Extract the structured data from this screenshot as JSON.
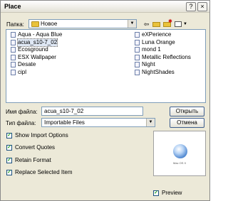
{
  "window": {
    "title": "Place",
    "help_label": "?",
    "close_label": "×"
  },
  "folder": {
    "label": "Папка:",
    "value": "Новое"
  },
  "files": {
    "left": [
      "Aqua - Aqua Blue",
      "acua_s10-7_02",
      "Ecosground",
      "ESX Wallpaper",
      "Desate",
      "cipl"
    ],
    "right": [
      "eXPerience",
      "Luna Orange",
      "mond 1",
      "Metallic Reflections",
      "Night",
      "NightShades"
    ],
    "selected": "acua_s10-7_02"
  },
  "filename": {
    "label": "Имя файла:",
    "value": "acua_s10-7_02"
  },
  "filetype": {
    "label": "Тип файла:",
    "value": "Importable Files"
  },
  "buttons": {
    "open": "Открыть",
    "cancel": "Отмена"
  },
  "options": [
    {
      "label": "Show Import Options",
      "checked": true
    },
    {
      "label": "Convert Quotes",
      "checked": true
    },
    {
      "label": "Retain Format",
      "checked": true
    },
    {
      "label": "Replace Selected Item",
      "checked": true
    }
  ],
  "preview": {
    "label": "Preview",
    "checked": true,
    "thumb_caption": "Mac OS X"
  },
  "icons": [
    "folder-icon",
    "back-arrow-icon",
    "up-folder-icon",
    "new-folder-icon",
    "view-menu-icon",
    "file-icon",
    "checkmark-icon"
  ]
}
